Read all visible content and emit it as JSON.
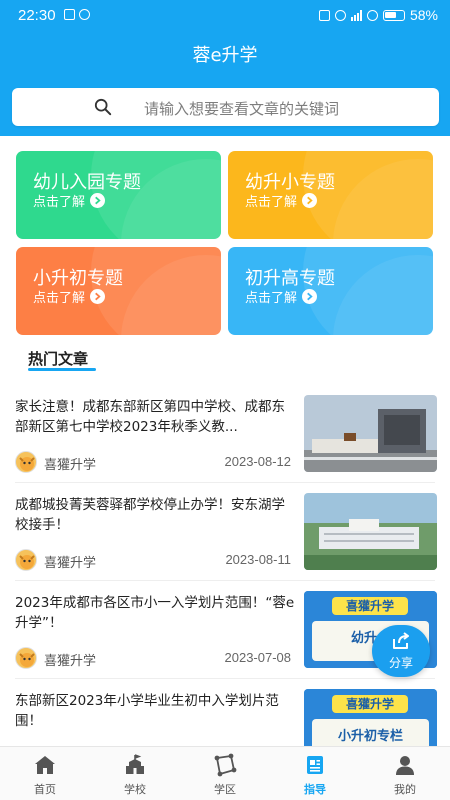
{
  "status_bar": {
    "time": "22:30",
    "battery": "58%"
  },
  "app": {
    "title": "蓉e升学"
  },
  "search": {
    "placeholder": "请输入想要查看文章的关键词"
  },
  "categories": [
    {
      "title": "幼儿入园专题",
      "subtitle": "点击了解",
      "color": "#2fd98e"
    },
    {
      "title": "幼升小专题",
      "subtitle": "点击了解",
      "color": "#fcb71c"
    },
    {
      "title": "小升初专题",
      "subtitle": "点击了解",
      "color": "#fd7f45"
    },
    {
      "title": "初升高专题",
      "subtitle": "点击了解",
      "color": "#38b6f6"
    }
  ],
  "section": {
    "title": "热门文章"
  },
  "articles": [
    {
      "title": "家长注意！成都东部新区第四中学校、成都东部新区第七中学校2023年秋季义教...",
      "author": "喜獾升学",
      "date": "2023-08-12"
    },
    {
      "title": "成都城投菁芙蓉驿都学校停止办学！安东湖学校接手！",
      "author": "喜獾升学",
      "date": "2023-08-11"
    },
    {
      "title": "2023年成都市各区市小一入学划片范围！“蓉e升学”！",
      "author": "喜獾升学",
      "date": "2023-07-08"
    },
    {
      "title": "东部新区2023年小学毕业生初中入学划片范围！",
      "author": "",
      "date": ""
    }
  ],
  "thumb_texts": {
    "banner_brand": "喜獾升学",
    "banner_3": "幼升小",
    "banner_4": "小升初专栏"
  },
  "share": {
    "label": "分享"
  },
  "nav": [
    {
      "label": "首页",
      "icon": "home-icon"
    },
    {
      "label": "学校",
      "icon": "school-icon"
    },
    {
      "label": "学区",
      "icon": "district-icon"
    },
    {
      "label": "指导",
      "icon": "guide-icon"
    },
    {
      "label": "我的",
      "icon": "profile-icon"
    }
  ],
  "nav_active": "指导",
  "colors": {
    "primary": "#17a6f2",
    "nav_active": "#17a6f2"
  }
}
